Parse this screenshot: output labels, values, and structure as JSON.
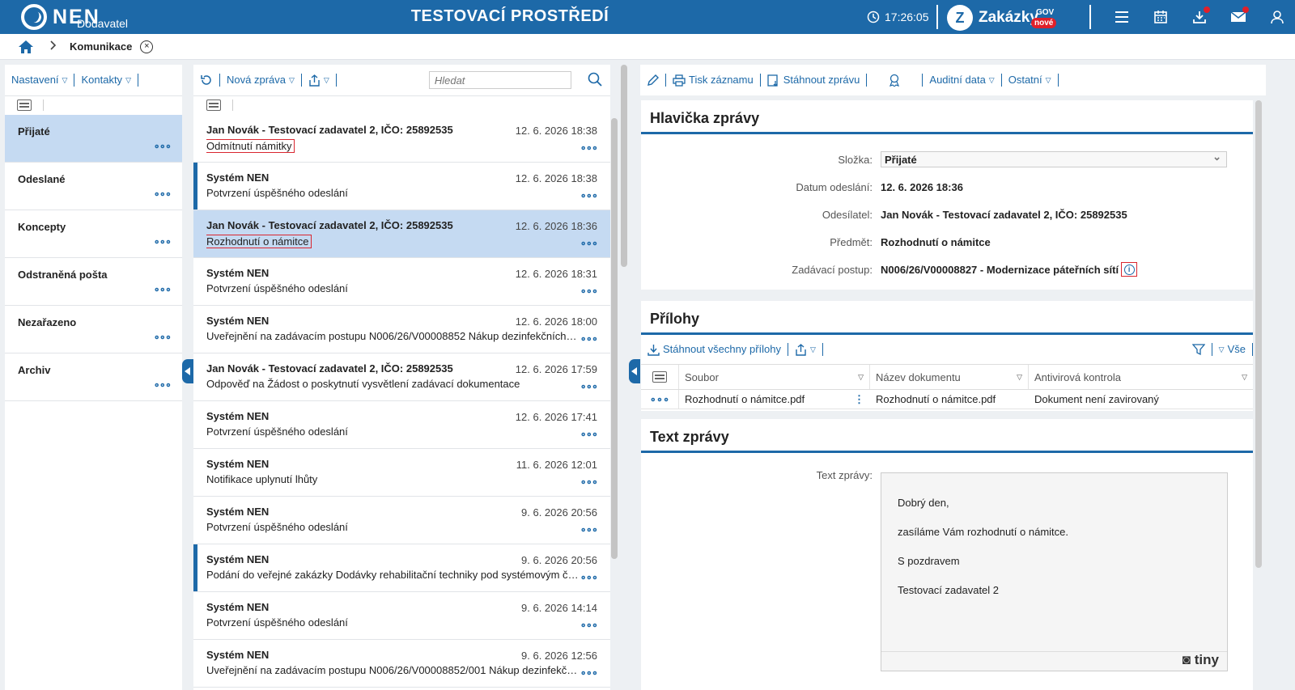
{
  "header": {
    "logo_text": "NEN",
    "logo_sub": "Dodavatel",
    "env_title": "TESTOVACÍ PROSTŘEDÍ",
    "time": "17:26:05",
    "zakazky_text": "Zakázky",
    "zakazky_gov": "GOV",
    "zakazky_badge": "nové"
  },
  "breadcrumb": {
    "label": "Komunikace"
  },
  "folders_toolbar": {
    "settings": "Nastavení",
    "contacts": "Kontakty"
  },
  "folders": [
    {
      "label": "Přijaté"
    },
    {
      "label": "Odeslané"
    },
    {
      "label": "Koncepty"
    },
    {
      "label": "Odstraněná pošta"
    },
    {
      "label": "Nezařazeno"
    },
    {
      "label": "Archiv"
    }
  ],
  "list_toolbar": {
    "new_message": "Nová zpráva",
    "search_placeholder": "Hledat"
  },
  "messages": [
    {
      "from": "Jan Novák - Testovací zadavatel 2, IČO: 25892535",
      "date": "12. 6. 2026 18:38",
      "subject": "Odmítnutí námitky"
    },
    {
      "from": "Systém NEN",
      "date": "12. 6. 2026 18:38",
      "subject": "Potvrzení úspěšného odeslání"
    },
    {
      "from": "Jan Novák - Testovací zadavatel 2, IČO: 25892535",
      "date": "12. 6. 2026 18:36",
      "subject": "Rozhodnutí o námitce"
    },
    {
      "from": "Systém NEN",
      "date": "12. 6. 2026 18:31",
      "subject": "Potvrzení úspěšného odeslání"
    },
    {
      "from": "Systém NEN",
      "date": "12. 6. 2026 18:00",
      "subject": "Uveřejnění na zadávacím postupu N006/26/V00008852 Nákup dezinfekčních p..."
    },
    {
      "from": "Jan Novák - Testovací zadavatel 2, IČO: 25892535",
      "date": "12. 6. 2026 17:59",
      "subject": "Odpověď na Žádost o poskytnutí vysvětlení zadávací dokumentace"
    },
    {
      "from": "Systém NEN",
      "date": "12. 6. 2026 17:41",
      "subject": "Potvrzení úspěšného odeslání"
    },
    {
      "from": "Systém NEN",
      "date": "11. 6. 2026 12:01",
      "subject": "Notifikace uplynutí lhůty"
    },
    {
      "from": "Systém NEN",
      "date": "9. 6. 2026 20:56",
      "subject": "Potvrzení úspěšného odeslání"
    },
    {
      "from": "Systém NEN",
      "date": "9. 6. 2026 20:56",
      "subject": "Podání do veřejné zakázky Dodávky rehabilitační techniky pod systémovým čísl..."
    },
    {
      "from": "Systém NEN",
      "date": "9. 6. 2026 14:14",
      "subject": "Potvrzení úspěšného odeslání"
    },
    {
      "from": "Systém NEN",
      "date": "9. 6. 2026 12:56",
      "subject": "Uveřejnění na zadávacím postupu N006/26/V00008852/001 Nákup dezinfekčn..."
    }
  ],
  "detail_toolbar": {
    "print": "Tisk záznamu",
    "download": "Stáhnout zprávu",
    "audit": "Auditní data",
    "other": "Ostatní"
  },
  "header_section": {
    "title": "Hlavička zprávy",
    "folder_label": "Složka:",
    "folder_value": "Přijaté",
    "date_label": "Datum odeslání:",
    "date_value": "12. 6. 2026 18:36",
    "sender_label": "Odesílatel:",
    "sender_value": "Jan Novák - Testovací zadavatel 2, IČO: 25892535",
    "subject_label": "Předmět:",
    "subject_value": "Rozhodnutí o námitce",
    "procedure_label": "Zadávací postup:",
    "procedure_value": "N006/26/V00008827 - Modernizace páteřních sítí"
  },
  "attachments": {
    "title": "Přílohy",
    "download_all": "Stáhnout všechny přílohy",
    "all": "Vše",
    "columns": [
      "Soubor",
      "Název dokumentu",
      "Antivirová kontrola"
    ],
    "rows": [
      [
        "Rozhodnutí o námitce.pdf",
        "Rozhodnutí o námitce.pdf",
        "Dokument není zavirovaný"
      ]
    ]
  },
  "text_section": {
    "title": "Text zprávy",
    "label": "Text zprávy:",
    "lines": [
      "Dobrý den,",
      "zasíláme Vám rozhodnutí o námitce.",
      "S pozdravem",
      "Testovací zadavatel 2"
    ],
    "editor_brand": "tiny"
  }
}
